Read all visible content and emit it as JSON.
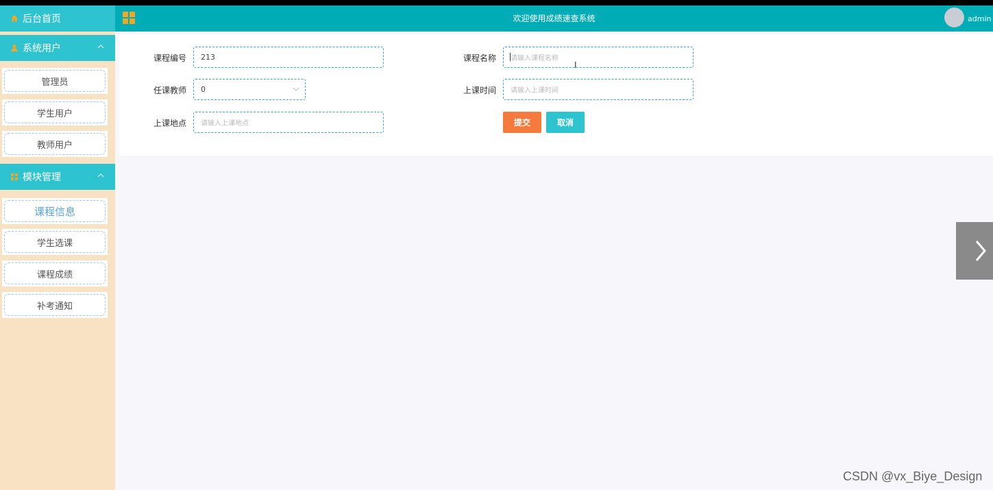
{
  "colors": {
    "accent": "#2ec4cf",
    "header": "#00acb6",
    "sidebar_bg": "#f7e3c4",
    "submit": "#f57a3d",
    "icon_orange": "#f5a623"
  },
  "sidebar": {
    "home": {
      "label": "后台首页",
      "icon": "home-icon"
    },
    "groups": [
      {
        "label": "系统用户",
        "icon": "user-icon",
        "items": [
          "管理员",
          "学生用户",
          "教师用户"
        ]
      },
      {
        "label": "模块管理",
        "icon": "grid-icon",
        "items": [
          "课程信息",
          "学生选课",
          "课程成绩",
          "补考通知"
        ],
        "active": "课程信息"
      }
    ]
  },
  "header": {
    "title": "欢迎使用成绩速查系统",
    "user": "admin",
    "menu_icon": "grid-icon"
  },
  "form": {
    "course_no": {
      "label": "课程编号",
      "value": "213"
    },
    "course_name": {
      "label": "课程名称",
      "placeholder": "请输入课程名称"
    },
    "teacher": {
      "label": "任课教师",
      "value": "0"
    },
    "class_time": {
      "label": "上课时间",
      "placeholder": "请输入上课时间"
    },
    "class_place": {
      "label": "上课地点",
      "placeholder": "请输入上课地点"
    },
    "submit_label": "提交",
    "cancel_label": "取消"
  },
  "watermark": "CSDN @vx_Biye_Design"
}
